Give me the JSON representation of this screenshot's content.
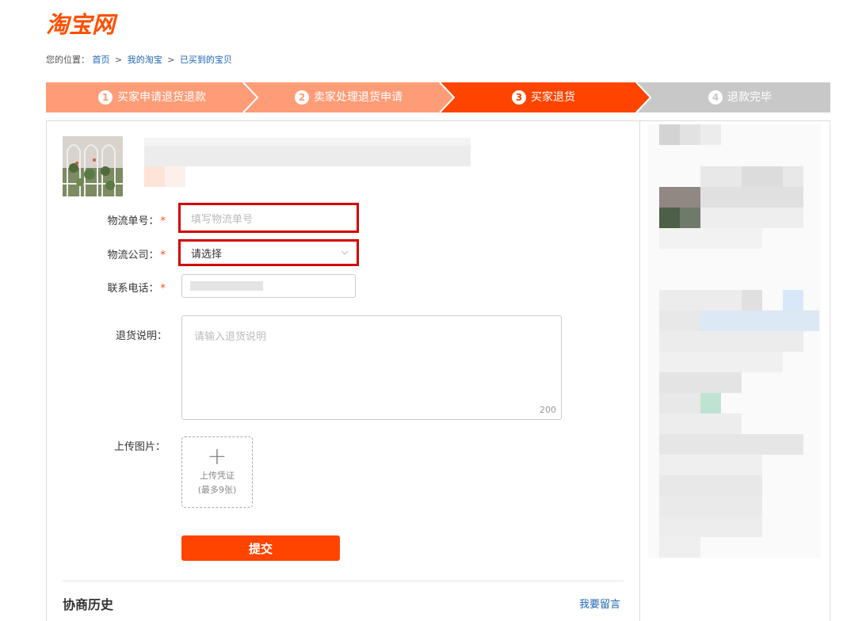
{
  "logo": "淘宝网",
  "breadcrumb": {
    "prefix": "您的位置：",
    "items": [
      "首页",
      "我的淘宝",
      "已买到的宝贝"
    ],
    "sep": ">"
  },
  "steps": [
    {
      "num": "1",
      "label": "买家申请退货退款",
      "state": "done"
    },
    {
      "num": "2",
      "label": "卖家处理退货申请",
      "state": "done"
    },
    {
      "num": "3",
      "label": "买家退货",
      "state": "current"
    },
    {
      "num": "4",
      "label": "退款完毕",
      "state": "pending"
    }
  ],
  "colors": {
    "done": "#ff9c78",
    "current": "#ff4400",
    "pending": "#c8c8c8",
    "accent": "#ff4400",
    "link": "#1c65b4"
  },
  "form": {
    "tracking_label": "物流单号：",
    "tracking_placeholder": "填写物流单号",
    "company_label": "物流公司：",
    "company_value": "请选择",
    "phone_label": "联系电话：",
    "note_label": "退货说明：",
    "note_placeholder": "请输入退货说明",
    "note_max": "200",
    "upload_label": "上传图片：",
    "upload_line1": "上传凭证",
    "upload_line2": "(最多9张)",
    "required_mark": "*",
    "submit": "提交"
  },
  "history": {
    "title": "协商历史",
    "leave_message": "我要留言"
  }
}
